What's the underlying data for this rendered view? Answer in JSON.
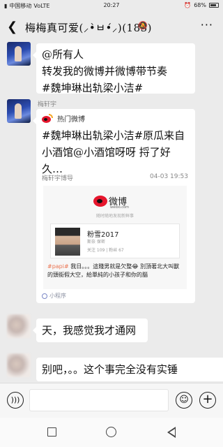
{
  "status_bar": {
    "carrier": "中国移动",
    "network": "VoLTE",
    "time": "20:27",
    "battery": "68%"
  },
  "header": {
    "back_icon": "back-arrow-icon",
    "title": "梅梅真可爱(⸝•̀ㅂ•́⸝)(183)",
    "mute_icon": "bell-muted-icon",
    "more_icon": "more-dots-icon"
  },
  "messages": [
    {
      "type": "text",
      "lines": [
        "@所有人",
        "转发我的微博并微博带节奏",
        "#魏坤琳出轨梁小洁#"
      ]
    },
    {
      "type": "weibo-card",
      "sender": "梅轩宇",
      "card": {
        "source": "热门微博",
        "lines": [
          "#魏坤琳出轨梁小洁#原瓜来自",
          "小酒馆@小酒馆呀呀 捋了好久…"
        ],
        "author": "梅轩宇博导",
        "date": "04-03 19:53",
        "preview": {
          "logo_text": "微博",
          "site": "weibo.com",
          "slogan": "随时随地发现新鲜事",
          "profile_name": "粉雪2017",
          "profile_sub": "斯奈 保密",
          "profile_stats": "关注 109 | 粉丝 67",
          "body_tag": "#papi#",
          "body_text": "我日。。。這賤男就是欠整😂 別頂著北大叫獸的頭銜假大空，給單純的小孩子和你的腦"
        },
        "footer": "小程序"
      }
    },
    {
      "type": "text",
      "lines": [
        "天，我感觉我才通网"
      ]
    },
    {
      "type": "text",
      "lines": [
        "别吧，。。这个事完全没有实锤"
      ]
    }
  ],
  "input_bar": {
    "voice_icon": "voice-icon",
    "placeholder": "",
    "emoji_icon": "emoji-icon",
    "plus_icon": "plus-icon"
  },
  "nav_bar": {
    "recent_icon": "square-icon",
    "home_icon": "circle-icon",
    "back_icon": "triangle-back-icon"
  }
}
